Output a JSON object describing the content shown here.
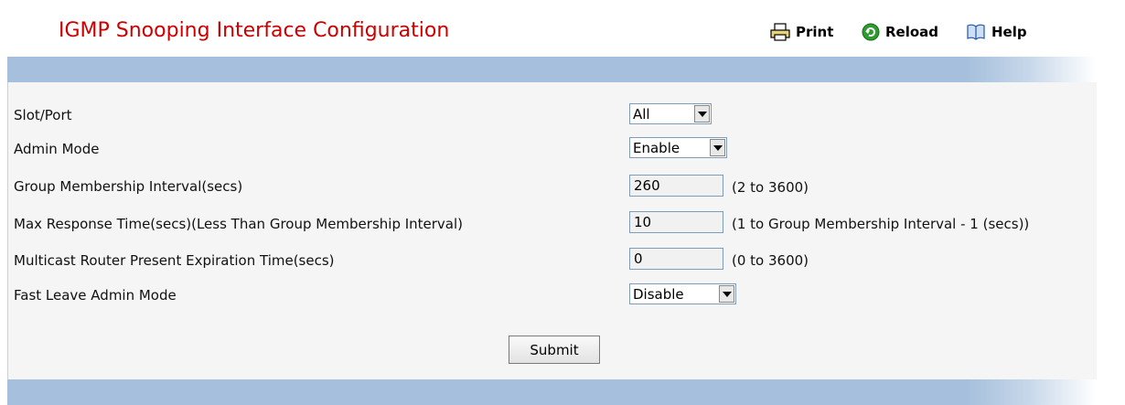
{
  "header": {
    "title": "IGMP Snooping Interface Configuration",
    "print_label": "Print",
    "reload_label": "Reload",
    "help_label": "Help",
    "title_color": "#cc0000",
    "band_color": "#a5bfdc"
  },
  "form": {
    "slot_port": {
      "label": "Slot/Port",
      "value": "All"
    },
    "admin_mode": {
      "label": "Admin Mode",
      "value": "Enable"
    },
    "group_membership_interval": {
      "label": "Group Membership Interval(secs)",
      "value": "260",
      "hint": "(2 to 3600)"
    },
    "max_response_time": {
      "label": "Max Response Time(secs)(Less Than Group Membership Interval)",
      "value": "10",
      "hint": "(1 to Group Membership Interval - 1 (secs))"
    },
    "mrouter_expiration": {
      "label": "Multicast Router Present Expiration Time(secs)",
      "value": "0",
      "hint": "(0 to 3600)"
    },
    "fast_leave": {
      "label": "Fast Leave Admin Mode",
      "value": "Disable"
    },
    "submit_label": "Submit"
  }
}
